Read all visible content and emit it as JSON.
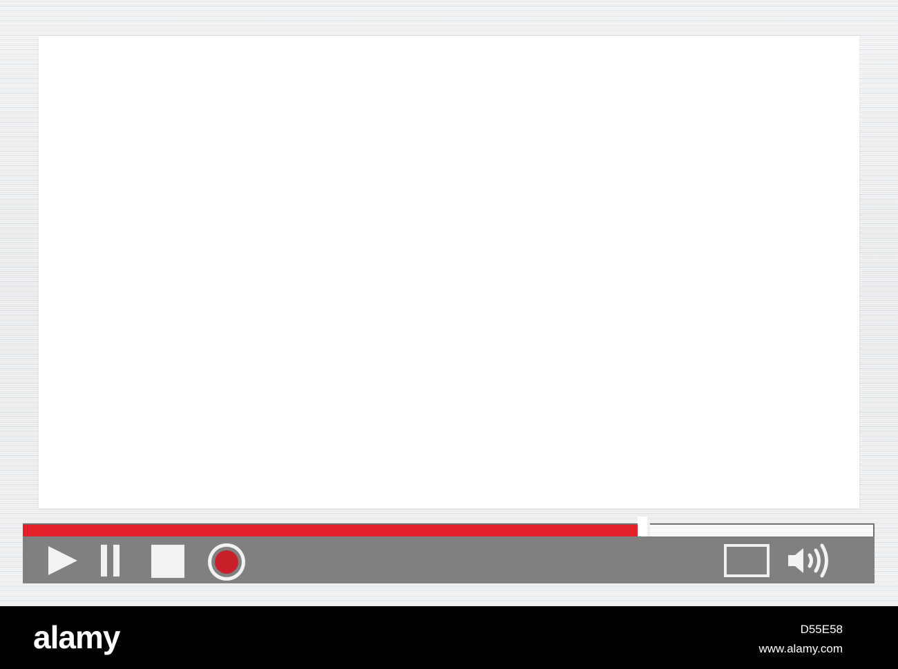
{
  "player": {
    "progress_fraction": 0.722,
    "colors": {
      "progress_played": "#e4212b",
      "control_bar": "#808080",
      "icon": "#f2f2f2",
      "record_dot": "#c8202a",
      "screen": "#ffffff"
    },
    "controls": [
      {
        "id": "play",
        "icon": "play-icon"
      },
      {
        "id": "pause",
        "icon": "pause-icon"
      },
      {
        "id": "stop",
        "icon": "stop-icon"
      },
      {
        "id": "record",
        "icon": "record-icon"
      },
      {
        "id": "fullscreen",
        "icon": "fullscreen-icon"
      },
      {
        "id": "volume",
        "icon": "volume-icon"
      }
    ]
  },
  "watermark": {
    "brand": "alamy",
    "image_id": "D55E58",
    "site": "www.alamy.com"
  }
}
